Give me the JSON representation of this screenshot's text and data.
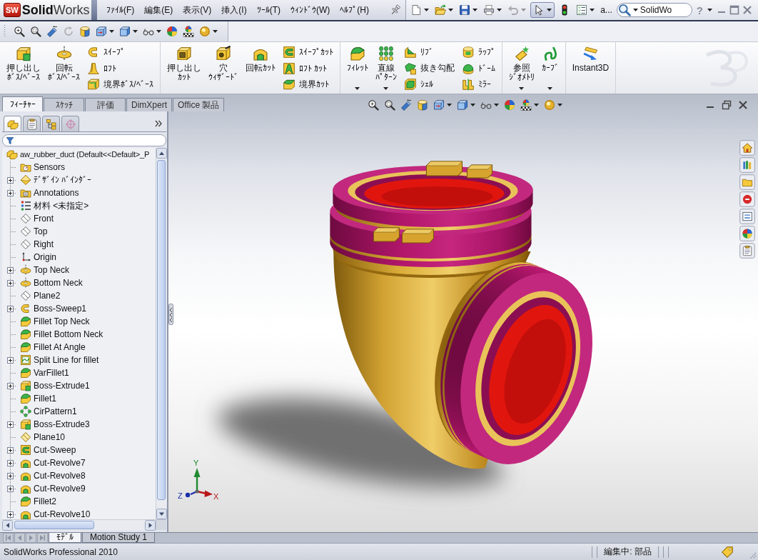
{
  "title_bar": {
    "logo_badge": "SW",
    "logo_text": "**Solid**Works",
    "menu": [
      "ﾌｧｲﾙ(F)",
      "編集(E)",
      "表示(V)",
      "挿入(I)",
      "ﾂｰﾙ(T)",
      "ｳｨﾝﾄﾞｳ(W)",
      "ﾍﾙﾌﾟ(H)"
    ],
    "quick_access": [
      {
        "kind": "pin",
        "dropdown": false,
        "disabled": false,
        "pressed": false
      },
      {
        "kind": "new",
        "dropdown": true,
        "disabled": false,
        "pressed": false
      },
      {
        "kind": "open",
        "dropdown": true,
        "disabled": false,
        "pressed": false
      },
      {
        "kind": "save",
        "dropdown": true,
        "disabled": false,
        "pressed": false
      },
      {
        "kind": "print",
        "dropdown": true,
        "disabled": false,
        "pressed": false
      },
      {
        "kind": "undo",
        "dropdown": true,
        "disabled": true,
        "pressed": false
      },
      {
        "kind": "select",
        "dropdown": true,
        "disabled": false,
        "pressed": true
      },
      {
        "kind": "rebuild",
        "dropdown": false,
        "disabled": false,
        "pressed": false
      },
      {
        "kind": "options",
        "dropdown": true,
        "disabled": false,
        "pressed": false
      }
    ],
    "overflow_label": "a...",
    "search": {
      "value": "SolidWo"
    },
    "help": {
      "label": "?"
    }
  },
  "view_toolbar": [
    {
      "kind": "zoom-fit",
      "dropdown": false,
      "disabled": false
    },
    {
      "kind": "zoom-area",
      "dropdown": false,
      "disabled": false
    },
    {
      "kind": "previous-view",
      "dropdown": false,
      "disabled": false
    },
    {
      "kind": "rotate",
      "dropdown": false,
      "disabled": true
    },
    {
      "kind": "section",
      "dropdown": false,
      "disabled": false
    },
    {
      "kind": "orientation",
      "dropdown": true,
      "disabled": false
    },
    {
      "kind": "display-style",
      "dropdown": true,
      "disabled": false
    },
    {
      "kind": "hide-show",
      "dropdown": true,
      "disabled": false
    },
    {
      "kind": "appearance",
      "dropdown": false,
      "disabled": false
    },
    {
      "kind": "scene",
      "dropdown": false,
      "disabled": false
    },
    {
      "kind": "realview",
      "dropdown": true,
      "disabled": false
    }
  ],
  "command_manager": {
    "groups": [
      {
        "items": [
          {
            "kind": "extrude-boss",
            "lines": [
              "押し出し",
              "ﾎﾞｽ/ﾍﾞｰｽ"
            ],
            "dropdown": false
          },
          {
            "kind": "revolve-boss",
            "lines": [
              "回転",
              "ﾎﾞｽ/ﾍﾞｰｽ"
            ],
            "dropdown": false
          },
          {
            "kind": "stack",
            "items": [
              {
                "kind": "sweep",
                "label": "ｽｲｰﾌﾟ"
              },
              {
                "kind": "loft",
                "label": "ﾛﾌﾄ"
              },
              {
                "kind": "boundary-boss",
                "label": "境界ﾎﾞｽ/ﾍﾞｰｽ"
              }
            ]
          }
        ]
      },
      {
        "items": [
          {
            "kind": "extrude-cut",
            "lines": [
              "押し出し",
              "ｶｯﾄ"
            ],
            "dropdown": false
          },
          {
            "kind": "hole",
            "lines": [
              "穴",
              "ｳｨｻﾞｰﾄﾞ"
            ],
            "dropdown": false
          },
          {
            "kind": "revolve-cut",
            "lines": [
              "回転ｶｯﾄ"
            ],
            "dropdown": false
          },
          {
            "kind": "stack",
            "items": [
              {
                "kind": "sweep-cut",
                "label": "ｽｲｰﾌﾟｶｯﾄ"
              },
              {
                "kind": "loft-cut",
                "label": "ﾛﾌﾄ ｶｯﾄ"
              },
              {
                "kind": "boundary-cut",
                "label": "境界ｶｯﾄ"
              }
            ]
          }
        ]
      },
      {
        "items": [
          {
            "kind": "fillet",
            "lines": [
              "ﾌｨﾚｯﾄ"
            ],
            "dropdown": true
          },
          {
            "kind": "linear-pattern",
            "lines": [
              "直線",
              "ﾊﾟﾀｰﾝ"
            ],
            "dropdown": true
          },
          {
            "kind": "stack",
            "items": [
              {
                "kind": "rib",
                "label": "ﾘﾌﾞ"
              },
              {
                "kind": "draft",
                "label": "抜き勾配"
              },
              {
                "kind": "shell",
                "label": "ｼｪﾙ"
              }
            ]
          },
          {
            "kind": "stack",
            "items": [
              {
                "kind": "wrap",
                "label": "ﾗｯﾌﾟ"
              },
              {
                "kind": "dome",
                "label": "ﾄﾞｰﾑ"
              },
              {
                "kind": "mirror",
                "label": "ﾐﾗｰ"
              }
            ]
          }
        ]
      },
      {
        "items": [
          {
            "kind": "ref-geometry",
            "lines": [
              "参照",
              "ｼﾞｵﾒﾄﾘ"
            ],
            "dropdown": true
          },
          {
            "kind": "curve",
            "lines": [
              "ｶｰﾌﾞ"
            ],
            "dropdown": true
          }
        ]
      },
      {
        "items": [
          {
            "kind": "instant3d",
            "lines": [
              "Instant3D"
            ],
            "dropdown": false
          }
        ]
      }
    ],
    "tabs": [
      {
        "label": "ﾌｨｰﾁｬｰ",
        "selected": true
      },
      {
        "label": "ｽｹｯﾁ",
        "selected": false
      },
      {
        "label": "評価",
        "selected": false
      },
      {
        "label": "DimXpert",
        "selected": false
      },
      {
        "label": "Office 製品",
        "selected": false
      }
    ]
  },
  "feature_manager": {
    "tabs": [
      {
        "kind": "feature-tree",
        "selected": true
      },
      {
        "kind": "property",
        "selected": false
      },
      {
        "kind": "configuration",
        "selected": false
      },
      {
        "kind": "dimxpert",
        "selected": false
      }
    ],
    "tree": {
      "label": "aw_rubber_duct (Default<<Default>_P",
      "kind": "part",
      "children": [
        {
          "label": "Sensors",
          "kind": "sensors",
          "expandable": false
        },
        {
          "label": "ﾃﾞｻﾞｲﾝ ﾊﾞｲﾝﾀﾞｰ",
          "kind": "binder",
          "expandable": true
        },
        {
          "label": "Annotations",
          "kind": "annotations",
          "expandable": true
        },
        {
          "label": "材料 <未指定>",
          "kind": "material",
          "expandable": false
        },
        {
          "label": "Front",
          "kind": "plane",
          "expandable": false
        },
        {
          "label": "Top",
          "kind": "plane",
          "expandable": false
        },
        {
          "label": "Right",
          "kind": "plane",
          "expandable": false
        },
        {
          "label": "Origin",
          "kind": "origin",
          "expandable": false
        },
        {
          "label": "Top Neck",
          "kind": "revolve-boss",
          "expandable": true
        },
        {
          "label": "Bottom Neck",
          "kind": "revolve-boss",
          "expandable": true
        },
        {
          "label": "Plane2",
          "kind": "plane",
          "expandable": false
        },
        {
          "label": "Boss-Sweep1",
          "kind": "sweep",
          "expandable": true
        },
        {
          "label": "Fillet Top Neck",
          "kind": "fillet",
          "expandable": false
        },
        {
          "label": "Fillet Bottom Neck",
          "kind": "fillet",
          "expandable": false
        },
        {
          "label": "Fillet At Angle",
          "kind": "fillet",
          "expandable": false
        },
        {
          "label": "Split Line for fillet",
          "kind": "split",
          "expandable": true
        },
        {
          "label": "VarFillet1",
          "kind": "fillet",
          "expandable": false
        },
        {
          "label": "Boss-Extrude1",
          "kind": "extrude-boss",
          "expandable": true
        },
        {
          "label": "Fillet1",
          "kind": "fillet",
          "expandable": false
        },
        {
          "label": "CirPattern1",
          "kind": "pattern",
          "expandable": false
        },
        {
          "label": "Boss-Extrude3",
          "kind": "extrude-boss",
          "expandable": true
        },
        {
          "label": "Plane10",
          "kind": "plane-highlight",
          "expandable": false
        },
        {
          "label": "Cut-Sweep",
          "kind": "sweep-cut",
          "expandable": true
        },
        {
          "label": "Cut-Revolve7",
          "kind": "revolve-cut",
          "expandable": true
        },
        {
          "label": "Cut-Revolve8",
          "kind": "revolve-cut",
          "expandable": true
        },
        {
          "label": "Cut-Revolve9",
          "kind": "revolve-cut",
          "expandable": true
        },
        {
          "label": "Fillet2",
          "kind": "fillet",
          "expandable": false
        },
        {
          "label": "Cut-Revolve10",
          "kind": "revolve-cut",
          "expandable": true
        }
      ]
    }
  },
  "graphics": {
    "view_toolbar": [
      {
        "kind": "zoom-fit",
        "dropdown": false
      },
      {
        "kind": "zoom-area",
        "dropdown": false
      },
      {
        "kind": "previous-view",
        "dropdown": false
      },
      {
        "kind": "section",
        "dropdown": false
      },
      {
        "kind": "orientation",
        "dropdown": true
      },
      {
        "kind": "display-style",
        "dropdown": true
      },
      {
        "kind": "hide-show",
        "dropdown": true
      },
      {
        "kind": "appearance",
        "dropdown": false
      },
      {
        "kind": "scene",
        "dropdown": true
      },
      {
        "kind": "realview",
        "dropdown": true
      }
    ],
    "axis_labels": [
      "Y",
      "X",
      "Z"
    ],
    "task_pane": [
      {
        "kind": "home"
      },
      {
        "kind": "resources"
      },
      {
        "kind": "library"
      },
      {
        "kind": "explorer"
      },
      {
        "kind": "palette"
      },
      {
        "kind": "appearances"
      },
      {
        "kind": "properties"
      }
    ]
  },
  "bottom_tabs": [
    {
      "label": "ﾓﾃﾞﾙ",
      "selected": true
    },
    {
      "label": "Motion Study 1",
      "selected": false
    }
  ],
  "status_bar": {
    "product": "SolidWorks Professional 2010",
    "mode": "編集中: 部品"
  }
}
